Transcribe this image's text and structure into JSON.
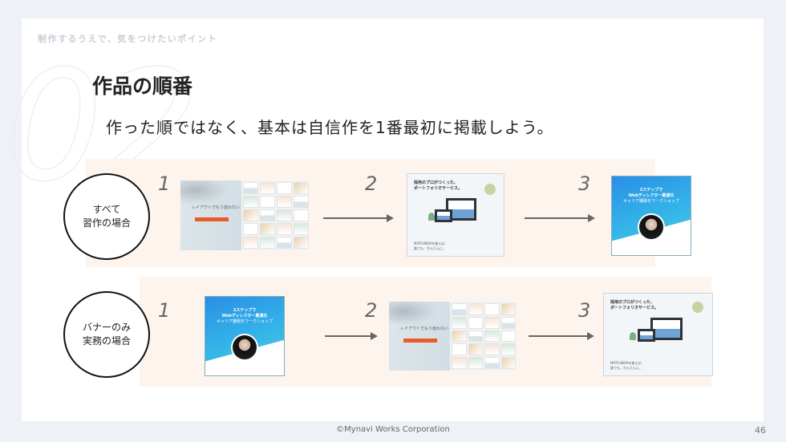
{
  "slide": {
    "section_label": "制作するうえで、気をつけたいポイント",
    "big_number": "02",
    "title": "作品の順番",
    "subtitle": "作った順ではなく、基本は自信作を1番最初に掲載しよう。"
  },
  "rows": [
    {
      "label_line1": "すべて",
      "label_line2": "習作の場合",
      "steps": [
        "1",
        "2",
        "3"
      ]
    },
    {
      "label_line1": "バナーのみ",
      "label_line2": "実務の場合",
      "steps": [
        "1",
        "2",
        "3"
      ]
    }
  ],
  "thumbnails": {
    "layout_site": {
      "heading": "レイアウトでもう迷わない",
      "button": ""
    },
    "portfolio_site": {
      "headline_line1": "採用のプロがつくった、",
      "headline_line2": "ポートフォリオサービス。",
      "footer_line1": "MATCHBOXを使えば、",
      "footer_line2": "誰でも、かんたんに。"
    },
    "banner": {
      "line1": "3ステップで",
      "line2": "Webディレクター最適化",
      "line3": "キャリア課題をワークショップ"
    }
  },
  "footer": {
    "copyright": "©Mynavi Works Corporation",
    "page_number": "46"
  },
  "colors": {
    "band": "#fdf4ee",
    "background": "#eef1f5",
    "accent_orange": "#e85b2a",
    "banner_blue": "#2a8fe6"
  }
}
